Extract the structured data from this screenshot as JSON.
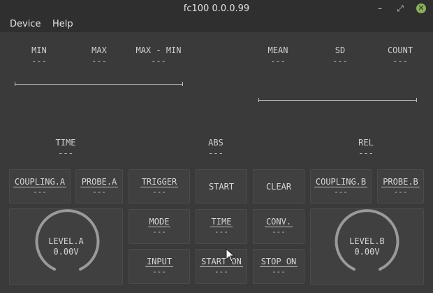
{
  "window": {
    "title": "fc100 0.0.0.99",
    "minimize_icon": "minimize-icon",
    "restore_icon": "restore-icon",
    "close_icon": "close-icon"
  },
  "menu": {
    "items": [
      "Device",
      "Help"
    ]
  },
  "stats_left": [
    {
      "label": "MIN",
      "value": "---"
    },
    {
      "label": "MAX",
      "value": "---"
    },
    {
      "label": "MAX - MIN",
      "value": "---"
    }
  ],
  "stats_right": [
    {
      "label": "MEAN",
      "value": "---"
    },
    {
      "label": "SD",
      "value": "---"
    },
    {
      "label": "COUNT",
      "value": "---"
    }
  ],
  "modes": [
    {
      "label": "TIME",
      "value": "---"
    },
    {
      "label": "ABS",
      "value": "---"
    },
    {
      "label": "REL",
      "value": "---"
    }
  ],
  "buttons": {
    "coupling_a": {
      "label": "COUPLING.A",
      "value": "---"
    },
    "probe_a": {
      "label": "PROBE.A",
      "value": "---"
    },
    "trigger": {
      "label": "TRIGGER",
      "value": "---"
    },
    "start": {
      "label": "START"
    },
    "clear": {
      "label": "CLEAR"
    },
    "coupling_b": {
      "label": "COUPLING.B",
      "value": "---"
    },
    "probe_b": {
      "label": "PROBE.B",
      "value": "---"
    },
    "mode": {
      "label": "MODE",
      "value": "---"
    },
    "time": {
      "label": "TIME",
      "value": "---"
    },
    "conv": {
      "label": "CONV.",
      "value": "---"
    },
    "input": {
      "label": "INPUT",
      "value": "---"
    },
    "start_on": {
      "label": "START ON",
      "value": "---"
    },
    "stop_on": {
      "label": "STOP ON",
      "value": "---"
    }
  },
  "knobs": {
    "level_a": {
      "label": "LEVEL.A",
      "value": "0.00V"
    },
    "level_b": {
      "label": "LEVEL.B",
      "value": "0.00V"
    }
  },
  "colors": {
    "background": "#3a3a3a",
    "panel": "#404040",
    "titlebar": "#2f2f2f",
    "accent_green": "#8bb158",
    "knob_arc": "#9a9a9a"
  }
}
